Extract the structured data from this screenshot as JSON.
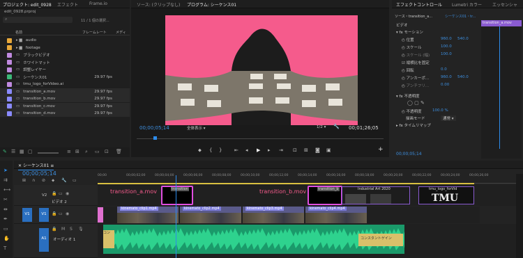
{
  "project_panel": {
    "tabs": [
      "プロジェクト: edit_0928",
      "エフェクト",
      "Frame.io"
    ],
    "filename": "edit_0928.prproj",
    "search_placeholder": "",
    "count": "11 / 1 個の選択...",
    "col_name": "名前",
    "col_framerate": "フレームレート",
    "col_media": "メディ",
    "items": [
      {
        "name": "audio",
        "fps": "",
        "color": "#e8a83a",
        "type": "folder"
      },
      {
        "name": "footage",
        "fps": "",
        "color": "#e8a83a",
        "type": "folder"
      },
      {
        "name": "ブラックビデオ",
        "fps": "",
        "color": "#c08ae0",
        "type": "item"
      },
      {
        "name": "ホワイトマット",
        "fps": "",
        "color": "#c08ae0",
        "type": "item"
      },
      {
        "name": "調整レイヤー",
        "fps": "",
        "color": "#c08ae0",
        "type": "item"
      },
      {
        "name": "シーケンス01",
        "fps": "29.97 fps",
        "color": "#3cb878",
        "type": "seq"
      },
      {
        "name": "tmu_logo_forVideo.ai",
        "fps": "",
        "color": "#c08ae0",
        "type": "item"
      },
      {
        "name": "transition_a.mov",
        "fps": "29.97 fps",
        "color": "#8a8aff",
        "type": "item"
      },
      {
        "name": "transition_b.mov",
        "fps": "29.97 fps",
        "color": "#8a8aff",
        "type": "item"
      },
      {
        "name": "transition_c.mov",
        "fps": "29.97 fps",
        "color": "#8a8aff",
        "type": "item"
      },
      {
        "name": "transition_d.mov",
        "fps": "29.97 fps",
        "color": "#8a8aff",
        "type": "item"
      }
    ]
  },
  "source_tab": "ソース: (クリップなし)",
  "program_tab": "プログラム: シーケンス01",
  "program": {
    "timecode": "00;00;05;14",
    "fit": "全体表示",
    "quality": "1/2",
    "duration": "00;01;26;05"
  },
  "effect_controls": {
    "tabs": [
      "エフェクトコントロール",
      "Lumetri カラー",
      "エッセンシャ"
    ],
    "source": "ソース・transition_a...",
    "seq": "シーケンス01・tr...",
    "clip_label": "transition_a.mov",
    "section_video": "ビデオ",
    "motion": "モーション",
    "rows": [
      {
        "label": "位置",
        "v1": "960.0",
        "v2": "540.0"
      },
      {
        "label": "スケール",
        "v1": "100.0",
        "v2": ""
      },
      {
        "label": "スケール (幅)",
        "v1": "100.0",
        "v2": ""
      },
      {
        "label": "縦横比を固定",
        "v1": "",
        "v2": ""
      },
      {
        "label": "回転",
        "v1": "0.0",
        "v2": ""
      },
      {
        "label": "アンカーポ...",
        "v1": "960.0",
        "v2": "540.0"
      },
      {
        "label": "アンチフリ...",
        "v1": "0.00",
        "v2": ""
      }
    ],
    "opacity": "不透明度",
    "opacity_val": "100.0 %",
    "blend_label": "描画モード",
    "blend_val": "通常",
    "timeremap": "タイムリマップ",
    "timecode": "00;00;05;14"
  },
  "timeline": {
    "tab": "シーケンス01",
    "timecode": "00;00;05;14",
    "ruler": [
      "00;00",
      "00;00;02;00",
      "00;00;04;00",
      "00;00;06;00",
      "00;00;08;00",
      "00;00;10;00",
      "00;00;12;00",
      "00;00;14;00",
      "00;00;16;00",
      "00;00;18;00",
      "00;00;20;00",
      "00;00;22;00",
      "00;00;24;00",
      "00;00;26;00"
    ],
    "v2_name": "ビデオ 2",
    "v2": "V2",
    "v1": "V1",
    "a1": "A1",
    "a1_name": "オーディオ 1",
    "label_a": "transition_a.mov",
    "label_b": "transition_b.mov",
    "clip_trans": "transition",
    "clip_trans_b": "transition_b",
    "clip_industrial": "Industrial Art 2020",
    "clip_logo": "tmu_logo_forVid",
    "logo_text": "TMU",
    "v1_clips": [
      "kinemato_clip1.mp4",
      "kinemato_clip2.mp4",
      "kinemato_clip3.mp4",
      "kinemato_clip4.mp4"
    ],
    "audio_text": "コンスタントゲイン",
    "audio_text2": "コン"
  }
}
